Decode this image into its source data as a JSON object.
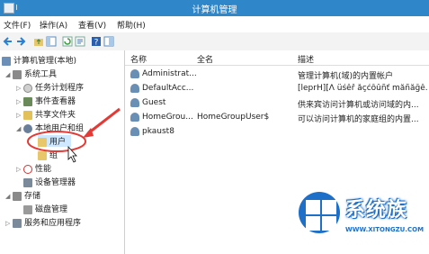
{
  "window": {
    "title": "计算机管理"
  },
  "menu": [
    "文件(F)",
    "操作(A)",
    "查看(V)",
    "帮助(H)"
  ],
  "tree": [
    {
      "label": "计算机管理(本地)",
      "icon": "computer-icon"
    },
    {
      "label": "系统工具",
      "icon": "tools-icon"
    },
    {
      "label": "任务计划程序",
      "icon": "clock-icon"
    },
    {
      "label": "事件查看器",
      "icon": "event-viewer-icon"
    },
    {
      "label": "共享文件夹",
      "icon": "shared-folder-icon"
    },
    {
      "label": "本地用户和组",
      "icon": "users-icon"
    },
    {
      "label": "用户",
      "icon": "folder-icon"
    },
    {
      "label": "组",
      "icon": "folder-icon"
    },
    {
      "label": "性能",
      "icon": "performance-icon"
    },
    {
      "label": "设备管理器",
      "icon": "device-manager-icon"
    },
    {
      "label": "存储",
      "icon": "storage-icon"
    },
    {
      "label": "磁盘管理",
      "icon": "disk-icon"
    },
    {
      "label": "服务和应用程序",
      "icon": "services-icon"
    }
  ],
  "columns": [
    "名称",
    "全名",
    "描述"
  ],
  "rows": [
    {
      "name": "Administrat...",
      "full": "",
      "desc": "管理计算机(域)的内置帐户"
    },
    {
      "name": "DefaultAcc...",
      "full": "",
      "desc": "[leprH][Λ üśêř åçćôûñť måñåğê..."
    },
    {
      "name": "Guest",
      "full": "",
      "desc": "供来宾访问计算机或访问域的内..."
    },
    {
      "name": "HomeGrou...",
      "full": "HomeGroupUser$",
      "desc": "可以访问计算机的家庭组的内置..."
    },
    {
      "name": "pkaust8",
      "full": "",
      "desc": ""
    }
  ],
  "watermark": {
    "brand": "系统族",
    "url": "WWW.XITONGZU.COM"
  },
  "colors": {
    "titlebar": "#2f86c9",
    "highlight": "#cde8ff",
    "annotation": "#e53935"
  }
}
